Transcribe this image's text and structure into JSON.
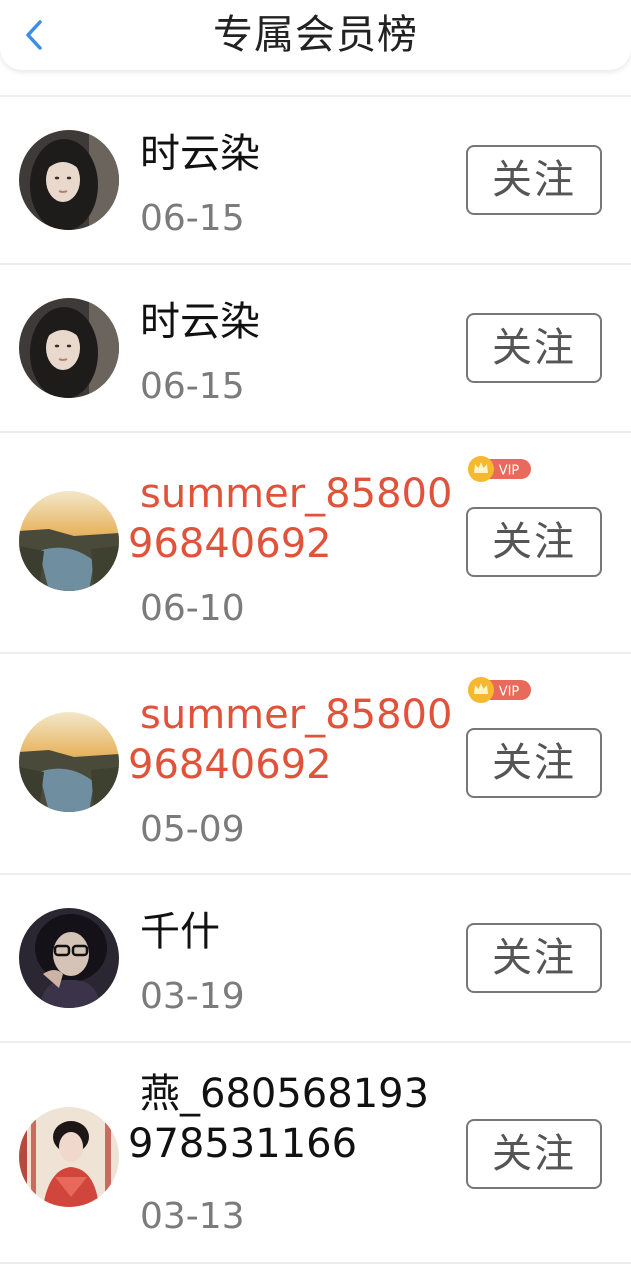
{
  "header": {
    "title": "专属会员榜",
    "back_icon": "chevron-left-icon"
  },
  "colors": {
    "accent": "#3a8ee6",
    "vip_name": "#e0533a",
    "date": "#7b7b7b",
    "vip_badge": "#e96a5a",
    "crown": "#f5b82e"
  },
  "follow_label": "关注",
  "vip_label": "VIP",
  "members": [
    {
      "name_line1": "时云染",
      "name_line2": "",
      "date": "06-15",
      "vip": false,
      "avatar": "hooded-woman-avatar"
    },
    {
      "name_line1": "时云染",
      "name_line2": "",
      "date": "06-15",
      "vip": false,
      "avatar": "hooded-woman-avatar"
    },
    {
      "name_line1": "summer_85800",
      "name_line2": "96840692",
      "date": "06-10",
      "vip": true,
      "avatar": "coast-sunset-avatar"
    },
    {
      "name_line1": "summer_85800",
      "name_line2": "96840692",
      "date": "05-09",
      "vip": true,
      "avatar": "coast-sunset-avatar"
    },
    {
      "name_line1": "千什",
      "name_line2": "",
      "date": "03-19",
      "vip": false,
      "avatar": "glasses-girl-avatar"
    },
    {
      "name_line1": "燕_680568193",
      "name_line2": "978531166",
      "date": "03-13",
      "vip": false,
      "avatar": "red-dress-woman-avatar"
    }
  ]
}
